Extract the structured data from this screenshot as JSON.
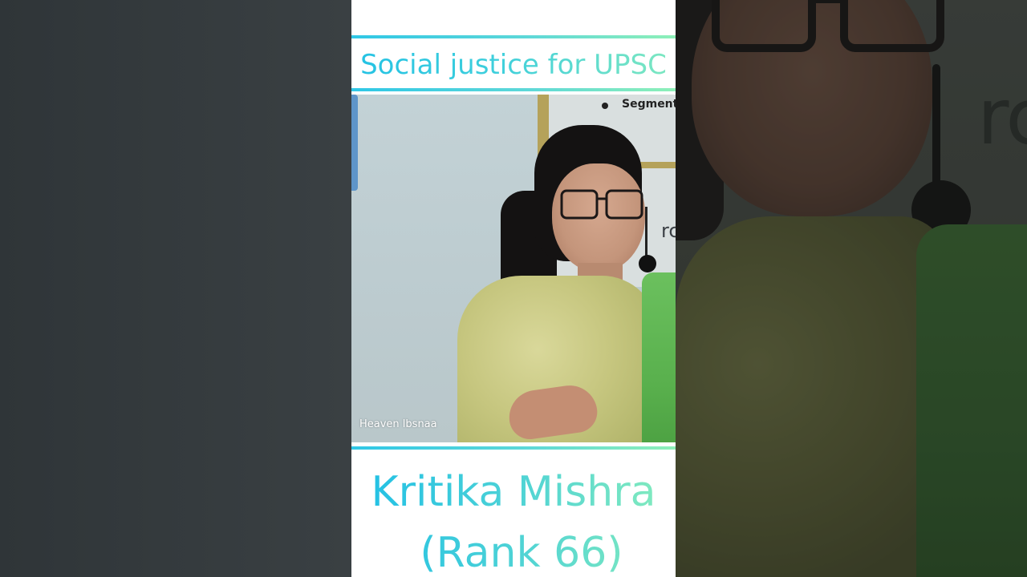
{
  "headline": "Social justice for UPSC",
  "person": {
    "name": "Kritika Mishra",
    "rank": "(Rank 66)"
  },
  "video": {
    "board_bullet_text": "Segment",
    "board_logo_text": "rce",
    "watermark": "Heaven lbsnaa"
  },
  "background": {
    "wall_text": "rce"
  },
  "colors": {
    "gradient_start": "#24c2e4",
    "gradient_end": "#86ecbc",
    "background_dark": "#2c3134",
    "dupatta_green": "#59b04d"
  }
}
